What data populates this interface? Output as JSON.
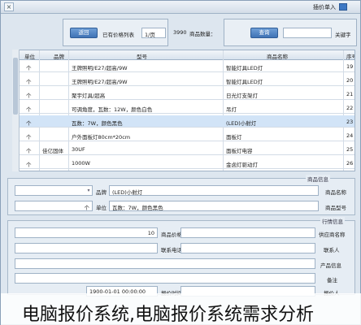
{
  "window": {
    "title": "插价单入"
  },
  "search": {
    "keyword_label": "关键字",
    "keyword_value": "",
    "query_button": "查询",
    "count_label": "商品数量：",
    "count_value": "3990",
    "back_button": "返回",
    "clear_label": "已有价格列表",
    "page_value": "1/页"
  },
  "table": {
    "headers": [
      "序号",
      "商品名称",
      "型号",
      "品牌",
      "单位"
    ],
    "rows": [
      {
        "num": "19",
        "name": "智能灯具LED灯",
        "model": "王牌照明/E27/超高/9W",
        "brand": "",
        "unit": "个"
      },
      {
        "num": "20",
        "name": "智能灯具LED灯",
        "model": "王牌照明/E27/超高/9W",
        "brand": "",
        "unit": "个"
      },
      {
        "num": "21",
        "name": "日光灯支架灯",
        "model": "聚宇灯具/超高",
        "brand": "",
        "unit": "个"
      },
      {
        "num": "22",
        "name": "吊灯",
        "model": "可调角度，瓦数：12W，颜色白色",
        "brand": "",
        "unit": "个"
      },
      {
        "num": "23",
        "name": "(LED)小射灯",
        "model": "瓦数：7W，颜色黑色",
        "brand": "",
        "unit": "个"
      },
      {
        "num": "24",
        "name": "面板灯",
        "model": "户外面板灯80cm*20cm",
        "brand": "",
        "unit": "个"
      },
      {
        "num": "25",
        "name": "面板灯电容",
        "model": "30UF",
        "brand": "佳亿固体",
        "unit": "个"
      },
      {
        "num": "26",
        "name": "金卤灯驱动灯",
        "model": "1000W",
        "brand": "",
        "unit": "个"
      }
    ]
  },
  "product_info": {
    "title": "商品信息",
    "name_label": "商品名称",
    "name_value": "(LED)小射灯",
    "brand_label": "品牌",
    "brand_value": "",
    "model_label": "商品型号",
    "model_value": "瓦数：7W，颜色黑色",
    "unit_label": "单位",
    "unit_value": "个"
  },
  "quote_info": {
    "title": "行情信息",
    "supplier_label": "供应商名称",
    "supplier_value": "",
    "price_label": "商品价格",
    "price_value": "10",
    "contact_label": "联系人",
    "contact_value": "",
    "phone_label": "联系电话",
    "phone_value": "",
    "origin_label": "产品信息",
    "origin_value": "",
    "remark_label": "备注",
    "remark_value": "",
    "date_value": "1900-01-01 00:00:00",
    "date_label": "报价时间",
    "submit_label": "报价人"
  },
  "caption": "电脑报价系统,电脑报价系统需求分析",
  "colors": {
    "button": "#3f73b5",
    "selected_row": "#d2e4f7"
  }
}
